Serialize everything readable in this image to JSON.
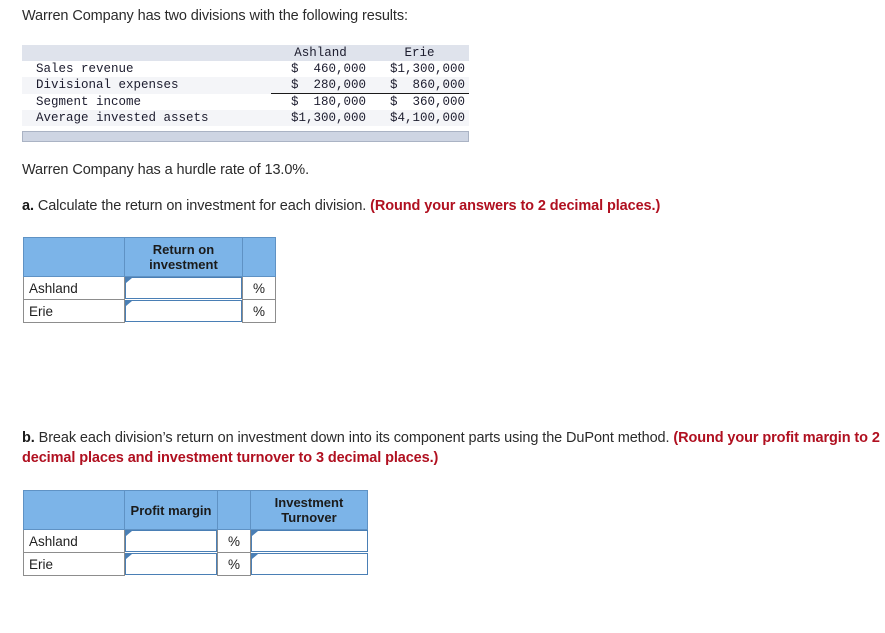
{
  "intro": {
    "line1": "Warren Company has two divisions with the following results:",
    "hurdle": "Warren Company has a hurdle rate of 13.0%."
  },
  "results_table": {
    "columns": [
      "",
      "Ashland",
      "Erie"
    ],
    "rows": [
      {
        "label": "Sales revenue",
        "ashland": "$  460,000",
        "erie": "$1,300,000"
      },
      {
        "label": "Divisional expenses",
        "ashland": "$  280,000",
        "erie": "$  860,000"
      },
      {
        "label": "Segment income",
        "ashland": "$  180,000",
        "erie": "$  360,000"
      },
      {
        "label": "Average invested assets",
        "ashland": "$1,300,000",
        "erie": "$4,100,000"
      }
    ]
  },
  "part_a": {
    "letter": "a.",
    "text": "Calculate the return on investment for each division.",
    "hint": "(Round your answers to 2 decimal places.)",
    "table": {
      "header_blank": "",
      "header_roi": "Return on investment",
      "header_pct_blank": "",
      "rows": [
        {
          "label": "Ashland",
          "roi_value": "",
          "pct": "%"
        },
        {
          "label": "Erie",
          "roi_value": "",
          "pct": "%"
        }
      ]
    }
  },
  "part_b": {
    "letter": "b.",
    "text": "Break each division’s return on investment down into its component parts using the DuPont method.",
    "hint": "(Round your profit margin to 2 decimal places and investment turnover to 3 decimal places.)",
    "table": {
      "header_blank": "",
      "header_profit_margin": "Profit margin",
      "header_pct_blank": "",
      "header_investment_turnover": "Investment Turnover",
      "rows": [
        {
          "label": "Ashland",
          "profit_margin": "",
          "pct": "%",
          "investment_turnover": ""
        },
        {
          "label": "Erie",
          "profit_margin": "",
          "pct": "%",
          "investment_turnover": ""
        }
      ]
    }
  },
  "colors": {
    "header_blue": "#7cb4e8",
    "hint_red": "#b01020",
    "table_header_gray": "#dfe3ec",
    "field_border": "#4a7fb5"
  }
}
